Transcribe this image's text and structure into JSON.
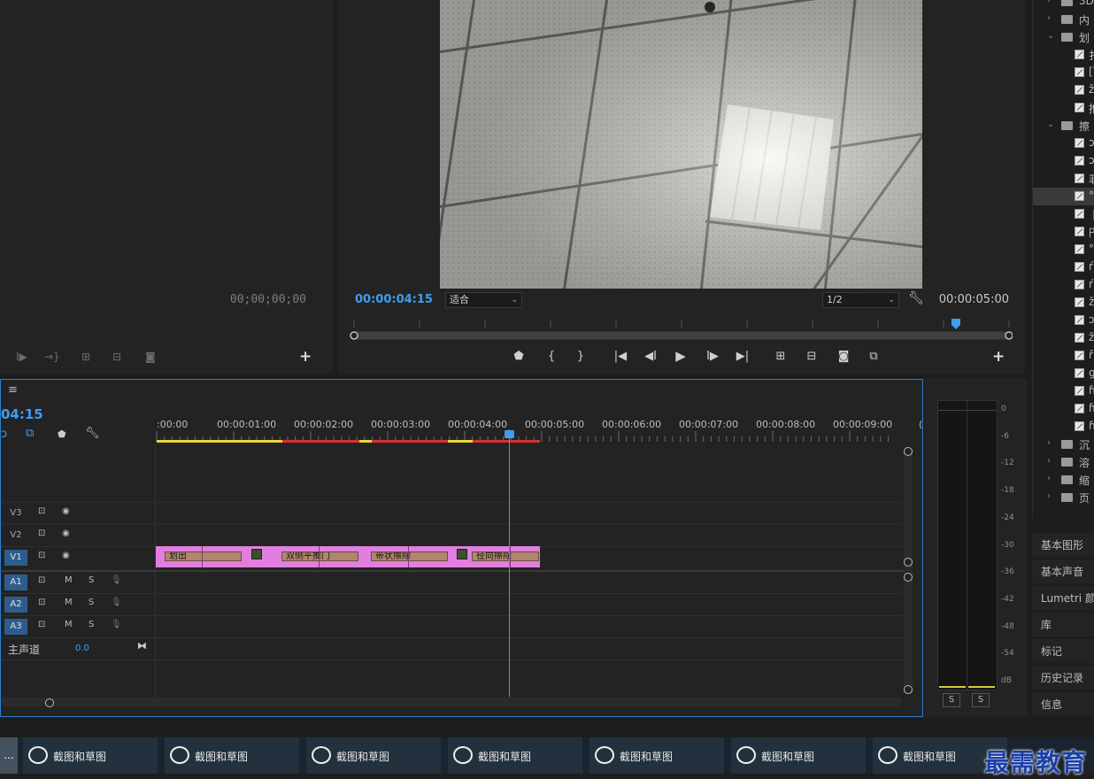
{
  "source_monitor": {
    "timecode": "00;00;00;00"
  },
  "program_monitor": {
    "current_timecode": "00:00:04:15",
    "fit_option": "适合",
    "resolution": "1/2",
    "duration": "00:00:05:00"
  },
  "project_panel": {
    "items": [
      {
        "type": "folder",
        "expanded": false,
        "label": "3D"
      },
      {
        "type": "folder",
        "expanded": false,
        "label": "内"
      },
      {
        "type": "folder",
        "expanded": true,
        "label": "划"
      },
      {
        "type": "effect",
        "label": "扌"
      },
      {
        "type": "effect",
        "label": "[‾"
      },
      {
        "type": "effect",
        "label": "ž"
      },
      {
        "type": "effect",
        "label": "推"
      },
      {
        "type": "folder",
        "expanded": true,
        "label": "擦"
      },
      {
        "type": "effect",
        "label": "ɔ"
      },
      {
        "type": "effect",
        "label": "ɔ"
      },
      {
        "type": "effect",
        "label": "菲"
      },
      {
        "type": "effect",
        "label": "°"
      },
      {
        "type": "effect",
        "label": "丨"
      },
      {
        "type": "effect",
        "label": "円"
      },
      {
        "type": "effect",
        "label": "°"
      },
      {
        "type": "effect",
        "label": "ŕ"
      },
      {
        "type": "effect",
        "label": "ŕ"
      },
      {
        "type": "effect",
        "label": "ž"
      },
      {
        "type": "effect",
        "label": "ɔ"
      },
      {
        "type": "effect",
        "label": "ž"
      },
      {
        "type": "effect",
        "label": "ř"
      },
      {
        "type": "effect",
        "label": "g"
      },
      {
        "type": "effect",
        "label": "ɦ"
      },
      {
        "type": "effect",
        "label": "ɦ"
      },
      {
        "type": "effect",
        "label": "ɦ"
      },
      {
        "type": "folder",
        "expanded": false,
        "label": "沉"
      },
      {
        "type": "folder",
        "expanded": false,
        "label": "溶"
      },
      {
        "type": "folder",
        "expanded": false,
        "label": "缩"
      },
      {
        "type": "folder",
        "expanded": false,
        "label": "页"
      }
    ],
    "side_panels": [
      "基本图形",
      "基本声音",
      "Lumetri 颜色",
      "库",
      "标记",
      "历史记录",
      "信息"
    ]
  },
  "timeline": {
    "timecode": "04:15",
    "ruler_labels": [
      ":00:00",
      "00:00:01:00",
      "00:00:02:00",
      "00:00:03:00",
      "00:00:04:00",
      "00:00:05:00",
      "00:00:06:00",
      "00:00:07:00",
      "00:00:08:00",
      "00:00:09:00",
      "("
    ],
    "video_tracks": [
      {
        "name": "V3",
        "active": false
      },
      {
        "name": "V2",
        "active": false
      },
      {
        "name": "V1",
        "active": true
      }
    ],
    "audio_tracks": [
      {
        "name": "A1",
        "mute": "M",
        "solo": "S"
      },
      {
        "name": "A2",
        "mute": "M",
        "solo": "S"
      },
      {
        "name": "A3",
        "mute": "M",
        "solo": "S"
      }
    ],
    "master": {
      "label": "主声道",
      "value": "0.0"
    },
    "clips": [
      "划出",
      "双侧平推门",
      "带状擦除",
      "径向擦除"
    ]
  },
  "audio_meter": {
    "db_labels": [
      "0",
      "-6",
      "-12",
      "-18",
      "-24",
      "-30",
      "-36",
      "-42",
      "-48",
      "-54",
      "dB"
    ],
    "solo_buttons": [
      "S",
      "S"
    ]
  },
  "taskbar": {
    "first": "...",
    "tasks": [
      "截图和草图",
      "截图和草图",
      "截图和草图",
      "截图和草图",
      "截图和草图",
      "截图和草图",
      "截图和草图"
    ],
    "brand": "最需教育"
  },
  "colors": {
    "accent_blue": "#3d9df0",
    "clip_pink": "#e27ee0",
    "clip_brown": "#b0866d",
    "render_yellow": "#e8d53a",
    "render_red": "#d43232"
  }
}
